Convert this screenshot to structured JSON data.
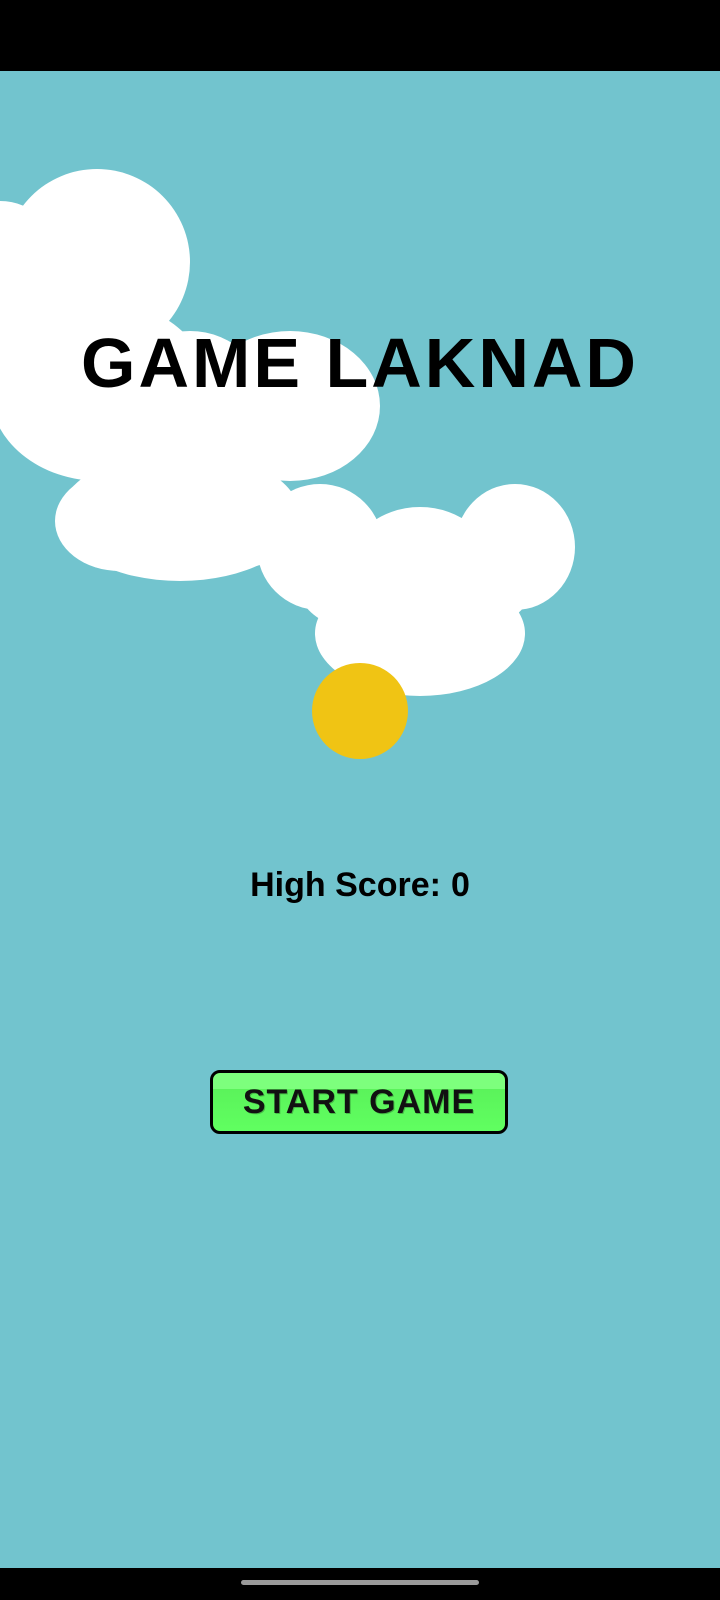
{
  "game": {
    "title": "GAME LAKNAD",
    "high_score_label": "High Score:",
    "high_score_value": "0",
    "start_button_label": "START GAME"
  },
  "colors": {
    "sky": "#72c4ce",
    "cloud": "#ffffff",
    "ball": "#f0c414",
    "button": "#66ff66",
    "text": "#000000"
  },
  "icons": {
    "ball": "yellow-ball-icon",
    "clouds": "cloud-icon"
  }
}
